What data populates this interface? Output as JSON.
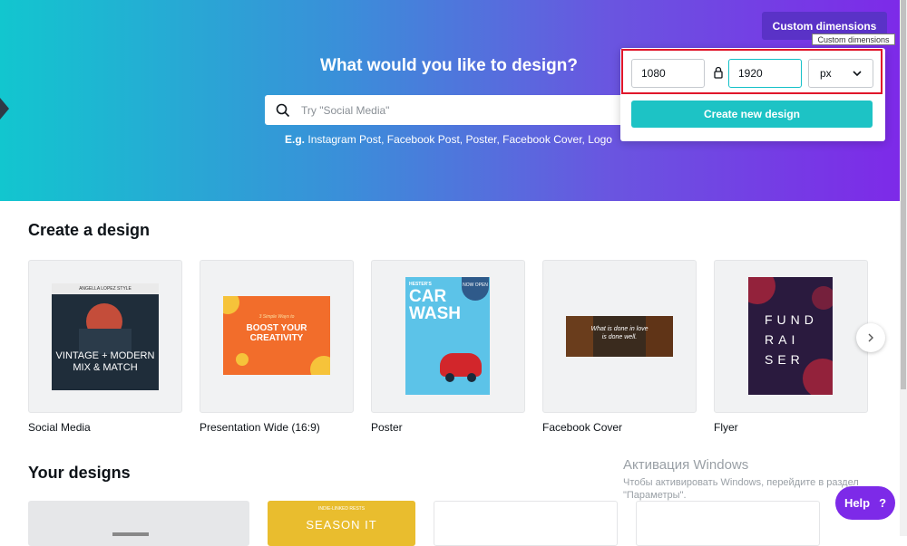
{
  "hero": {
    "title": "What would you like to design?",
    "search_placeholder": "Try \"Social Media\"",
    "examples_prefix": "E.g.",
    "examples": [
      "Instagram Post",
      "Facebook Post",
      "Poster",
      "Facebook Cover",
      "Logo"
    ],
    "examples_sep": ", "
  },
  "custom": {
    "button_label": "Custom dimensions",
    "tooltip": "Custom dimensions",
    "width": "1080",
    "height": "1920",
    "unit": "px",
    "create_label": "Create new design"
  },
  "create": {
    "title": "Create a design",
    "cards": [
      {
        "label": "Social Media",
        "thumb_lines": [
          "VINTAGE + MODERN",
          "MIX & MATCH"
        ],
        "thumb_top": "ANGELLA LOPEZ STYLE"
      },
      {
        "label": "Presentation Wide (16:9)",
        "thumb_lines": [
          "BOOST YOUR",
          "CREATIVITY"
        ],
        "thumb_top": "3 Simple Ways to"
      },
      {
        "label": "Poster",
        "thumb_lines": [
          "CAR",
          "WASH"
        ],
        "thumb_top": "HESTER'S",
        "badge": "NOW OPEN"
      },
      {
        "label": "Facebook Cover",
        "thumb_lines": [
          "What is done in love",
          "is done well."
        ]
      },
      {
        "label": "Flyer",
        "thumb_lines": [
          "FUND",
          "RAI",
          "SER"
        ]
      }
    ]
  },
  "yours": {
    "title": "Your designs",
    "card2_text": "SEASON IT",
    "card2_top": "INDIE-LINKED RESTS"
  },
  "activation": {
    "title": "Активация Windows",
    "line1": "Чтобы активировать Windows, перейдите в раздел",
    "line2": "\"Параметры\"."
  },
  "help": {
    "label": "Help",
    "icon": "?"
  },
  "colors": {
    "accent": "#7d2ae8",
    "teal": "#1dc3c5",
    "highlight": "#e0162b"
  }
}
